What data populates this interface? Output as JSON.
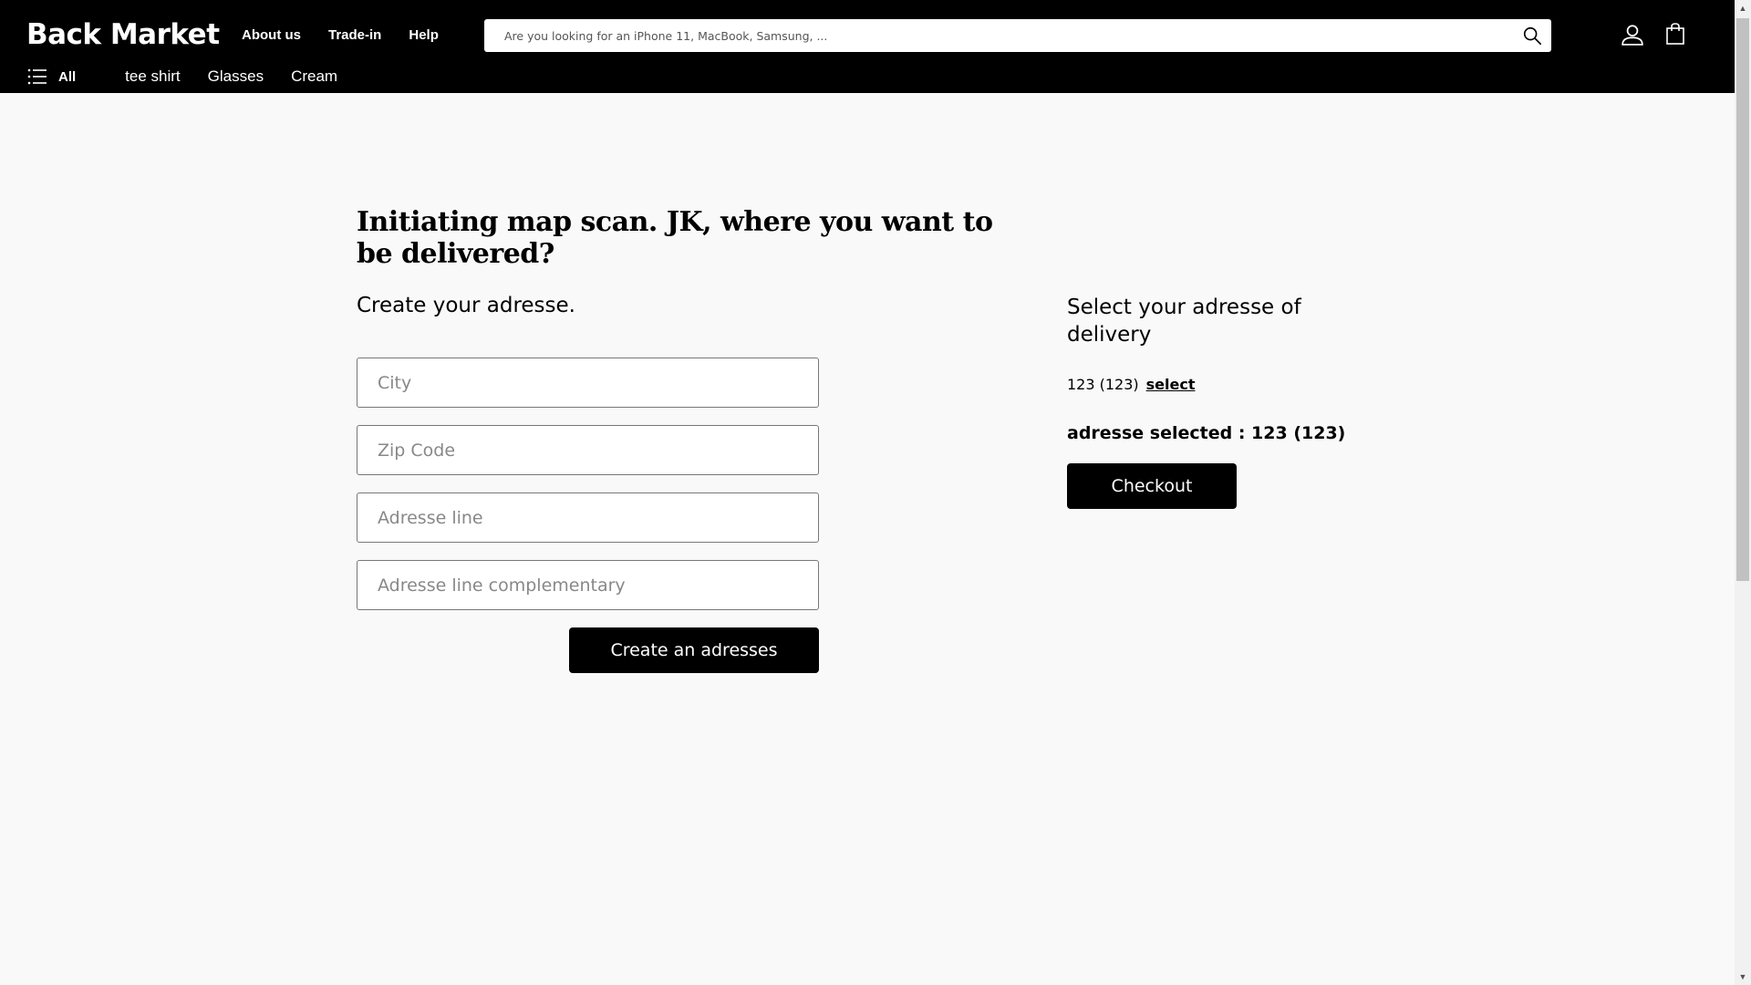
{
  "header": {
    "logo": "Back Market",
    "nav": [
      "About us",
      "Trade-in",
      "Help"
    ],
    "search_placeholder": "Are you looking for an iPhone 11, MacBook, Samsung, ...",
    "all_label": "All",
    "categories": [
      "tee shirt",
      "Glasses",
      "Cream"
    ]
  },
  "main": {
    "title": "Initiating map scan. JK, where you want to be delivered?",
    "create_heading": "Create your adresse.",
    "fields": {
      "city_placeholder": "City",
      "zip_placeholder": "Zip Code",
      "address_placeholder": "Adresse line",
      "address2_placeholder": "Adresse line complementary"
    },
    "create_button": "Create an adresses"
  },
  "delivery": {
    "heading": "Select your adresse of delivery",
    "address_item": "123 (123)",
    "select_link": "select",
    "selected_text": "adresse selected : 123 (123)",
    "checkout_button": "Checkout"
  },
  "colors": {
    "header_bg": "#000000",
    "page_bg": "#f9f9f9",
    "button_bg": "#000000"
  },
  "icons": [
    "menu-icon",
    "search-icon",
    "user-icon",
    "bag-icon"
  ]
}
